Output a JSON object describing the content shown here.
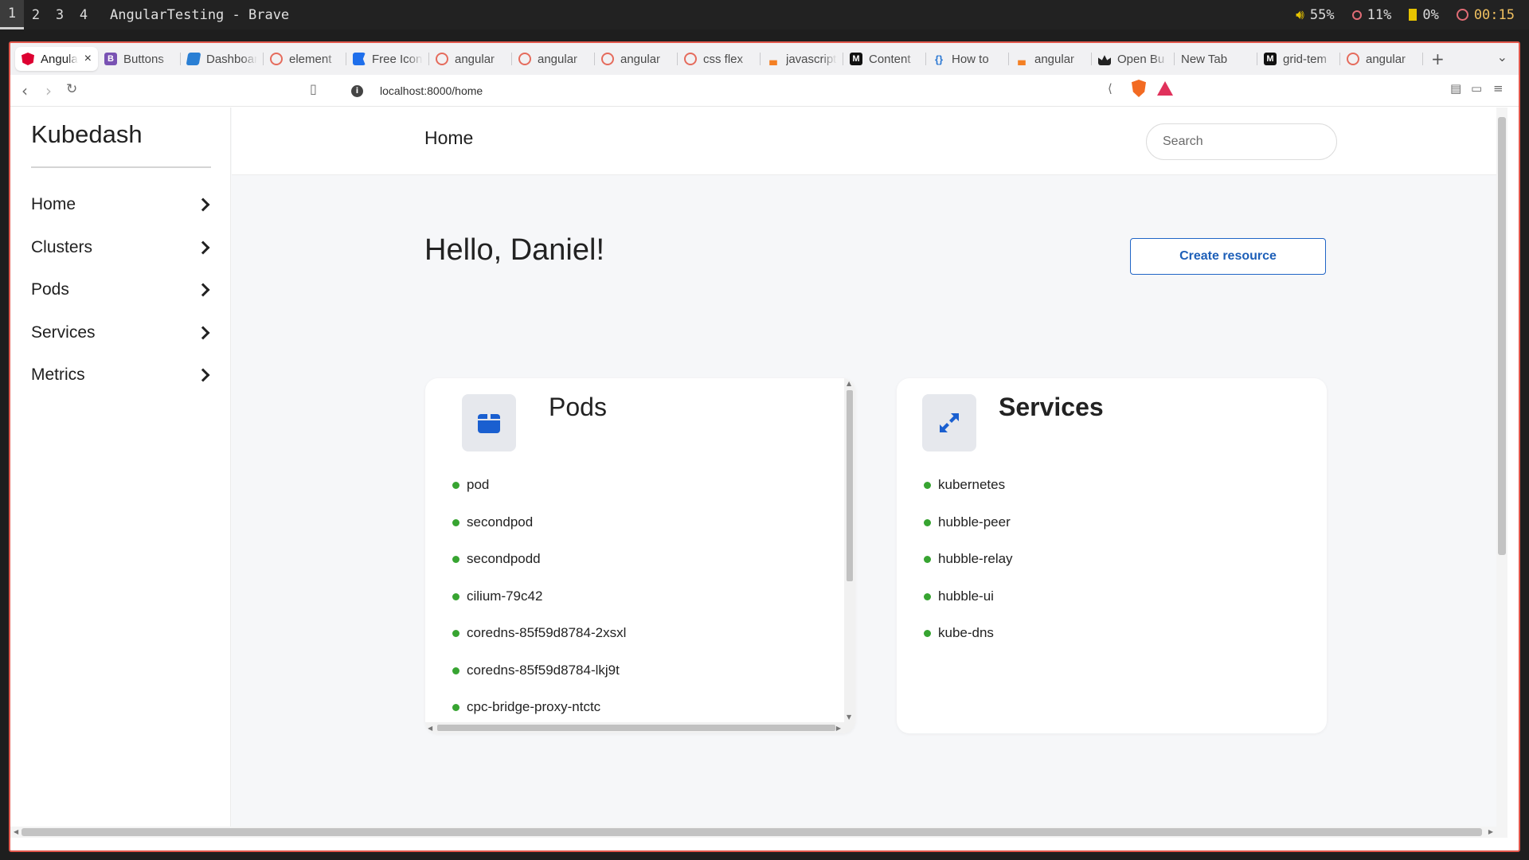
{
  "wm": {
    "workspaces": [
      "1",
      "2",
      "3",
      "4"
    ],
    "title": "AngularTesting - Brave",
    "volume": "55%",
    "cpu": "11%",
    "battery": "0%",
    "clock": "00:15"
  },
  "browser": {
    "tabs": [
      {
        "label": "Angular",
        "icon": "angular-icon",
        "active": true
      },
      {
        "label": "Buttons",
        "icon": "bootstrap-icon"
      },
      {
        "label": "Dashboard",
        "icon": "layers-icon"
      },
      {
        "label": "element",
        "icon": "brave-icon"
      },
      {
        "label": "Free Icons",
        "icon": "flag-icon"
      },
      {
        "label": "angular",
        "icon": "brave-icon"
      },
      {
        "label": "angular",
        "icon": "brave-icon"
      },
      {
        "label": "angular",
        "icon": "brave-icon"
      },
      {
        "label": "css flex",
        "icon": "brave-icon"
      },
      {
        "label": "javascript",
        "icon": "stackoverflow-icon"
      },
      {
        "label": "Content",
        "icon": "mdn-icon"
      },
      {
        "label": "How to",
        "icon": "code-braces-icon"
      },
      {
        "label": "angular",
        "icon": "stackoverflow-icon"
      },
      {
        "label": "Open Bu",
        "icon": "openbuild-icon"
      },
      {
        "label": "New Tab",
        "icon": ""
      },
      {
        "label": "grid-tem",
        "icon": "mdn-icon"
      },
      {
        "label": "angular",
        "icon": "brave-icon"
      }
    ],
    "new_tab": "+",
    "url": "localhost:8000/home"
  },
  "app": {
    "brand": "Kubedash",
    "nav": [
      {
        "label": "Home"
      },
      {
        "label": "Clusters"
      },
      {
        "label": "Pods"
      },
      {
        "label": "Services"
      },
      {
        "label": "Metrics"
      }
    ],
    "topbar_title": "Home",
    "search_placeholder": "Search",
    "greeting": "Hello, Daniel!",
    "create_button": "Create resource",
    "pods_card": {
      "title": "Pods",
      "items": [
        "pod",
        "secondpod",
        "secondpodd",
        "cilium-79c42",
        "coredns-85f59d8784-2xsxl",
        "coredns-85f59d8784-lkj9t",
        "cpc-bridge-proxy-ntctc"
      ]
    },
    "services_card": {
      "title": "Services",
      "items": [
        "kubernetes",
        "hubble-peer",
        "hubble-relay",
        "hubble-ui",
        "kube-dns"
      ]
    }
  },
  "colors": {
    "accent": "#2065c6",
    "status_ok": "#37a431",
    "window_border": "#e2574c"
  }
}
